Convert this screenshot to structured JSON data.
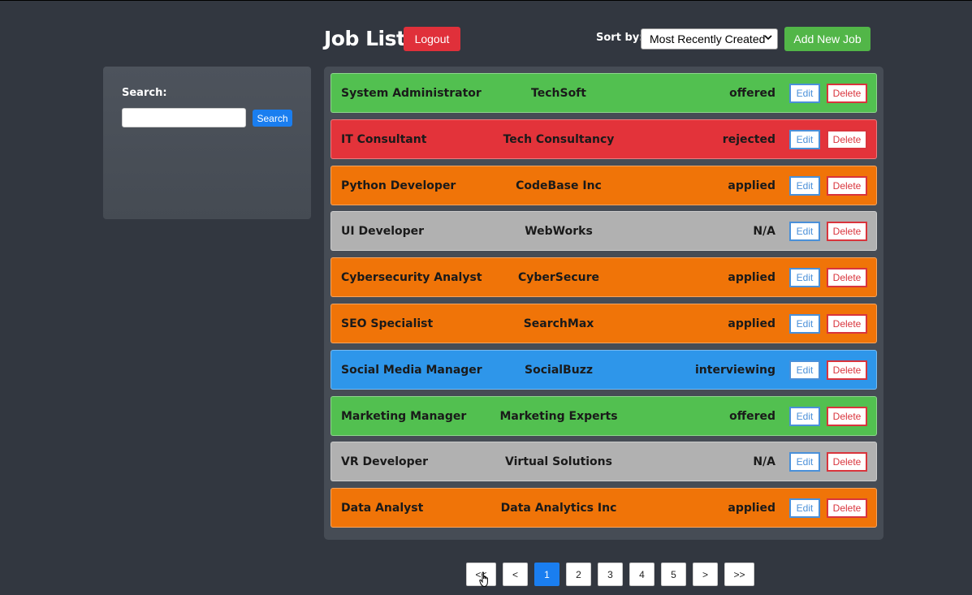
{
  "header": {
    "title": "Job List",
    "logout_label": "Logout",
    "sort_label": "Sort by:",
    "sort_selected": "Most Recently Created",
    "add_label": "Add New Job"
  },
  "search": {
    "label": "Search:",
    "value": "",
    "button_label": "Search"
  },
  "jobs": [
    {
      "title": "System Administrator",
      "company": "TechSoft",
      "status": "offered",
      "color": "#52c050"
    },
    {
      "title": "IT Consultant",
      "company": "Tech Consultancy",
      "status": "rejected",
      "color": "#e3333a"
    },
    {
      "title": "Python Developer",
      "company": "CodeBase Inc",
      "status": "applied",
      "color": "#f07408"
    },
    {
      "title": "UI Developer",
      "company": "WebWorks",
      "status": "N/A",
      "color": "#b1b1b1"
    },
    {
      "title": "Cybersecurity Analyst",
      "company": "CyberSecure",
      "status": "applied",
      "color": "#f07408"
    },
    {
      "title": "SEO Specialist",
      "company": "SearchMax",
      "status": "applied",
      "color": "#f07408"
    },
    {
      "title": "Social Media Manager",
      "company": "SocialBuzz",
      "status": "interviewing",
      "color": "#2e96ea"
    },
    {
      "title": "Marketing Manager",
      "company": "Marketing Experts",
      "status": "offered",
      "color": "#52c050"
    },
    {
      "title": "VR Developer",
      "company": "Virtual Solutions",
      "status": "N/A",
      "color": "#b1b1b1"
    },
    {
      "title": "Data Analyst",
      "company": "Data Analytics Inc",
      "status": "applied",
      "color": "#f07408"
    }
  ],
  "row_actions": {
    "edit_label": "Edit",
    "delete_label": "Delete"
  },
  "pagination": {
    "first_label": "<<",
    "prev_label": "<",
    "pages": [
      "1",
      "2",
      "3",
      "4",
      "5"
    ],
    "current_page": "1",
    "next_label": ">",
    "last_label": ">>"
  },
  "colors": {
    "background": "#323740",
    "logout": "#e0303a",
    "add": "#52b648",
    "search_button": "#1a7ef0",
    "active_page": "#1a7ef0"
  }
}
